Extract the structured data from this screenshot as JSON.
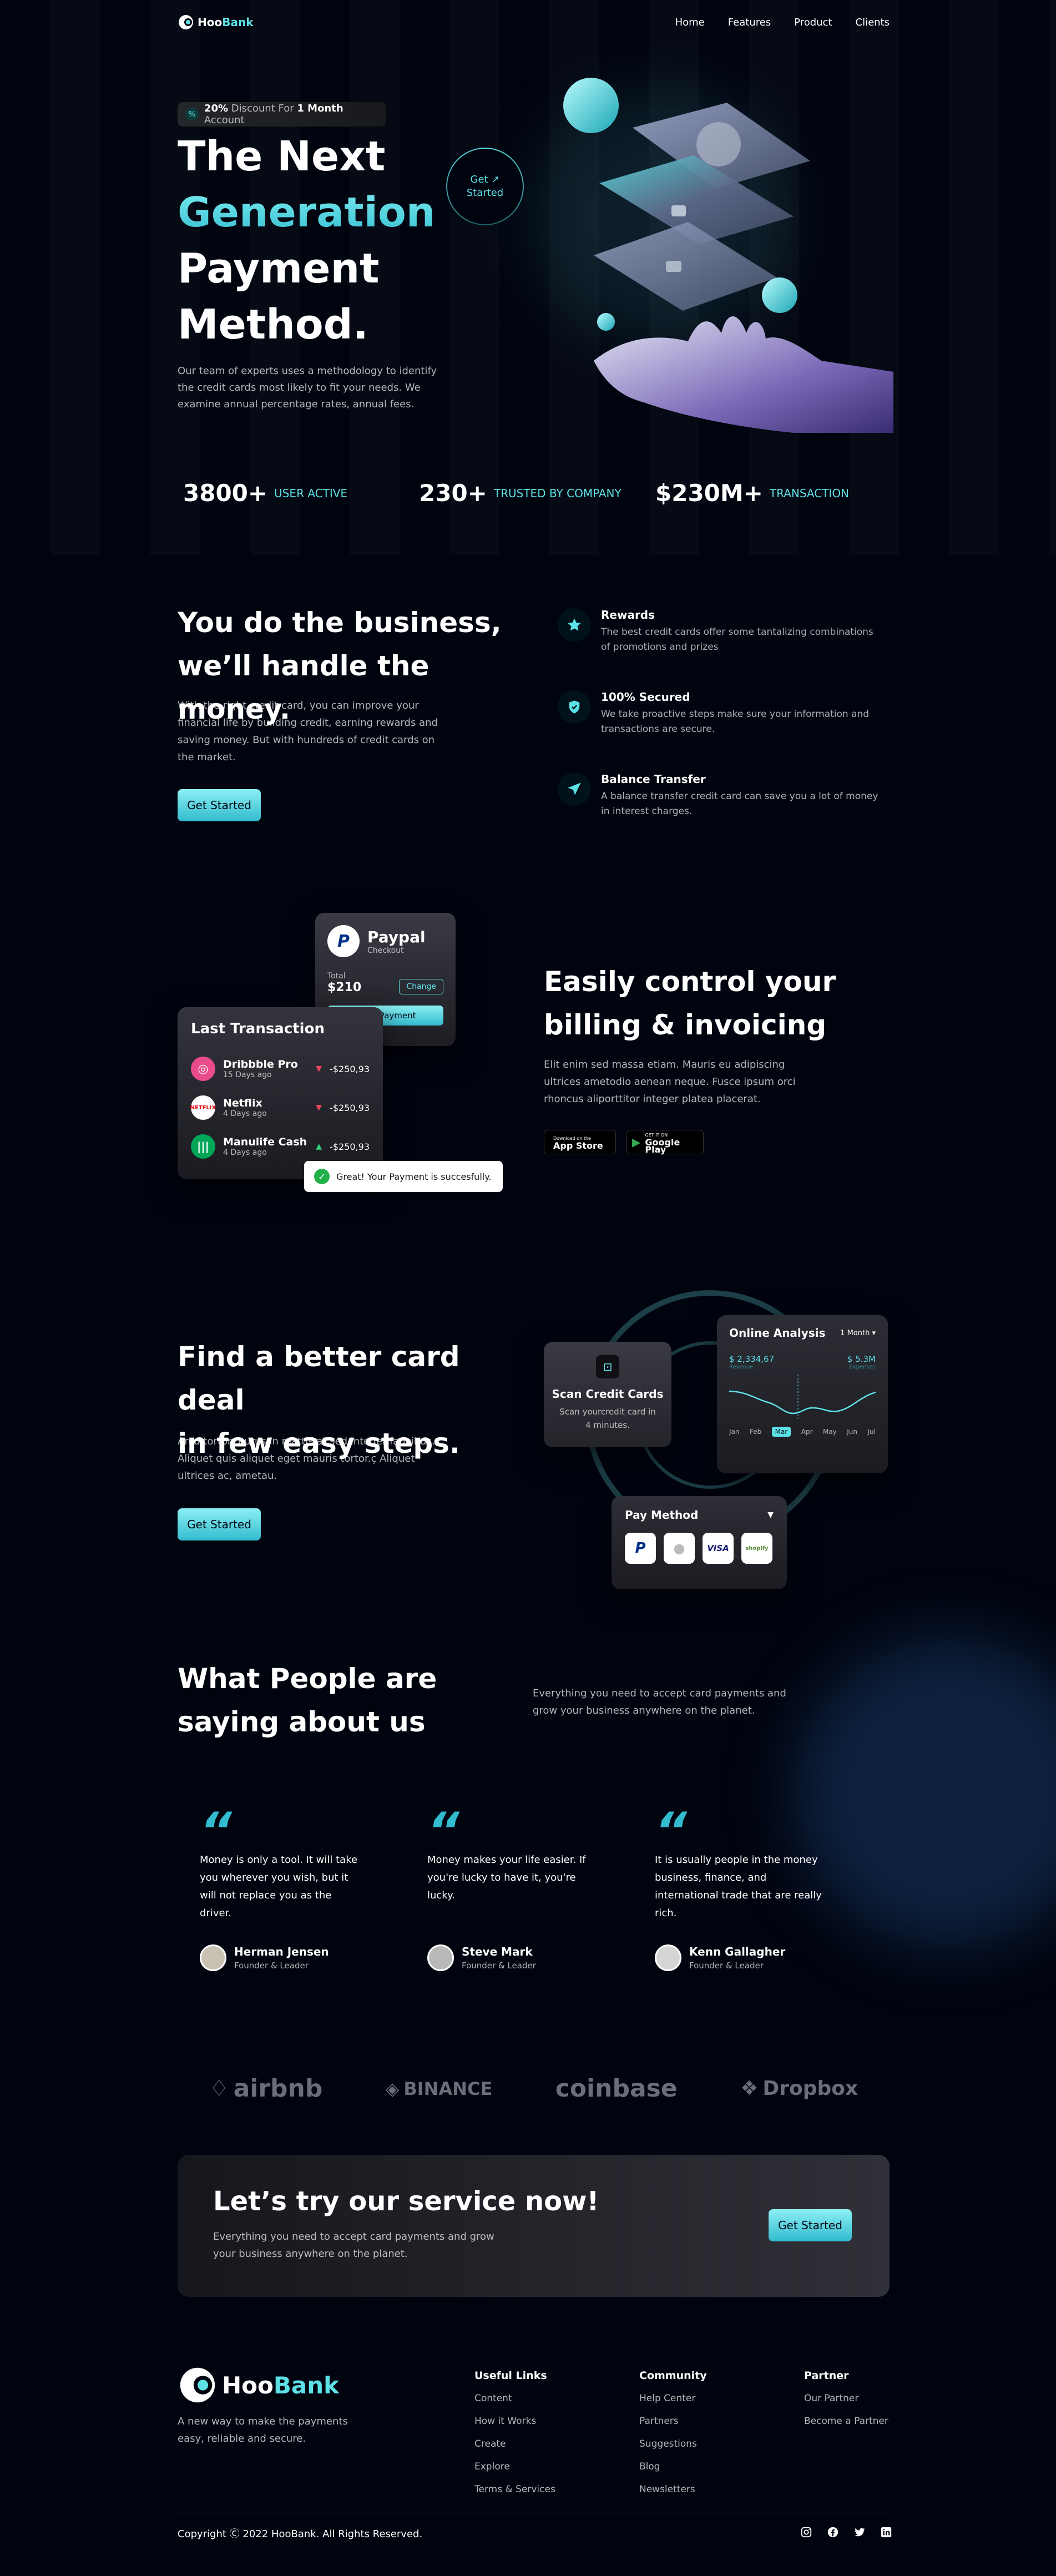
{
  "brand": {
    "name_a": "Hoo",
    "name_b": "Bank"
  },
  "nav": {
    "items": [
      "Home",
      "Features",
      "Product",
      "Clients"
    ]
  },
  "hero": {
    "badge_strong": "20%",
    "badge_text_1": "Discount For",
    "badge_strong_2": "1 Month",
    "badge_text_2": "Account",
    "title_1": "The Next",
    "title_2": "Generation",
    "title_3": "Payment",
    "title_4": "Method.",
    "cta_line_1": "Get",
    "cta_line_2": "Started",
    "description": "Our team of experts uses a methodology to identify the credit cards most likely to fit your needs. We examine annual percentage rates, annual fees."
  },
  "stats": [
    {
      "value": "3800+",
      "label": "USER ACTIVE"
    },
    {
      "value": "230+",
      "label": "TRUSTED BY COMPANY"
    },
    {
      "value": "$230M+",
      "label": "TRANSACTION"
    }
  ],
  "business": {
    "title_1": "You do the business,",
    "title_2": "we’ll handle the money.",
    "description": "With the right credit card, you can improve your financial life by building credit, earning rewards and saving money. But with hundreds of credit cards on the market.",
    "button": "Get Started",
    "features": [
      {
        "icon": "star-icon",
        "title": "Rewards",
        "text": "The best credit cards offer some tantalizing combinations of promotions and prizes"
      },
      {
        "icon": "shield-icon",
        "title": "100% Secured",
        "text": "We take proactive steps make sure your information and transactions are secure."
      },
      {
        "icon": "send-icon",
        "title": "Balance Transfer",
        "text": "A balance transfer credit card can save you a lot of money in interest charges."
      }
    ]
  },
  "billing": {
    "paypal_title": "Paypal",
    "paypal_sub": "Checkout",
    "total_label": "Total",
    "total_value": "$210",
    "change_label": "Change",
    "make_payment": "Make Payment",
    "last_transaction": "Last Transaction",
    "transactions": [
      {
        "name": "Dribbble Pro",
        "time": "15 Days ago",
        "amount": "-$250,93",
        "dir": "down"
      },
      {
        "name": "Netflix",
        "time": "4 Days ago",
        "amount": "-$250,93",
        "dir": "down"
      },
      {
        "name": "Manulife Cash",
        "time": "4 Days ago",
        "amount": "-$250,93",
        "dir": "up"
      }
    ],
    "toast": "Great! Your Payment is succesfully.",
    "title_1": "Easily control your",
    "title_2": "billing & invoicing",
    "description": "Elit enim sed massa etiam. Mauris eu adipiscing ultrices ametodio aenean neque. Fusce ipsum orci rhoncus aliporttitor integer platea placerat.",
    "appstore_small": "Download on the",
    "appstore_big": "App Store",
    "googleplay_small": "GET IT ON",
    "googleplay_big": "Google Play"
  },
  "steps": {
    "title_1": "Find a better card deal",
    "title_2": "in few easy steps.",
    "description": "Arcu tortor, purus in mattis at sed integer faucibus. Aliquet quis aliquet eget mauris tortor.ç Aliquet ultrices ac, ametau.",
    "button": "Get Started",
    "scan_title": "Scan Credit Cards",
    "scan_text": "Scan yourcredit card in 4 minutes.",
    "analysis_title": "Online Analysis",
    "analysis_period": "1 Month",
    "revenue_value": "$ 2,334,67",
    "revenue_label": "Revenue",
    "expenses_value": "$ 5.3M",
    "expenses_label": "Expenses",
    "months": [
      "Jan",
      "Feb",
      "Mar",
      "Apr",
      "May",
      "Jun",
      "Jul"
    ],
    "active_month": "Mar",
    "pay_method_title": "Pay Method",
    "pay_methods": [
      "paypal",
      "apple",
      "VISA",
      "shopify"
    ]
  },
  "testimonials": {
    "title_1": "What People are",
    "title_2": "saying about us",
    "description": "Everything you need to accept card payments and grow your business anywhere on the planet.",
    "items": [
      {
        "quote": "Money is only a tool. It will take you wherever you wish, but it will not replace you as the driver.",
        "name": "Herman Jensen",
        "role": "Founder & Leader"
      },
      {
        "quote": "Money makes your life easier. If you're lucky to have it, you're lucky.",
        "name": "Steve Mark",
        "role": "Founder & Leader"
      },
      {
        "quote": "It is usually people in the money business, finance, and international trade that are really rich.",
        "name": "Kenn Gallagher",
        "role": "Founder & Leader"
      }
    ]
  },
  "clients": [
    "airbnb",
    "BINANCE",
    "coinbase",
    "Dropbox"
  ],
  "cta": {
    "title": "Let’s try our service now!",
    "description": "Everything you need to accept card payments and grow your business anywhere on the planet.",
    "button": "Get Started"
  },
  "footer": {
    "tagline": "A new way to make the payments easy, reliable and secure.",
    "columns": [
      {
        "title": "Useful Links",
        "links": [
          "Content",
          "How it Works",
          "Create",
          "Explore",
          "Terms & Services"
        ]
      },
      {
        "title": "Community",
        "links": [
          "Help Center",
          "Partners",
          "Suggestions",
          "Blog",
          "Newsletters"
        ]
      },
      {
        "title": "Partner",
        "links": [
          "Our Partner",
          "Become a Partner"
        ]
      }
    ],
    "copyright": "Copyright Ⓒ 2022 HooBank. All Rights Reserved.",
    "socials": [
      "instagram-icon",
      "facebook-icon",
      "twitter-icon",
      "linkedin-icon"
    ]
  },
  "colors": {
    "bg": "#00040f",
    "accent": "#5ce1e6",
    "accent_dark": "#33bbcf"
  }
}
